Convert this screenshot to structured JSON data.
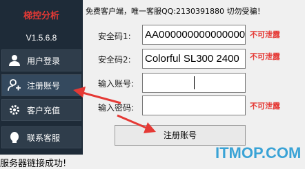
{
  "sidebar": {
    "app_title": "梯控分析",
    "version": "V1.5.6.8",
    "items": [
      {
        "label": "用户登录",
        "icon": "user-icon"
      },
      {
        "label": "注册账号",
        "icon": "user-add-icon"
      },
      {
        "label": "客户充值",
        "icon": "gear-icon"
      },
      {
        "label": "联系客服",
        "icon": "chat-icon"
      }
    ]
  },
  "notice": "免费客户端，唯一客服QQ:2130391880 切勿受骗！",
  "form": {
    "code1_label": "安全码1:",
    "code1_value": "AA000000000000000",
    "code2_label": "安全码2:",
    "code2_value": "Colorful SL300 2400",
    "account_label": "输入账号:",
    "account_value": "",
    "password_label": "输入密码:",
    "password_value": "",
    "warn_text": "不可泄露"
  },
  "register_button": "注册账号",
  "status": "服务器链接成功!",
  "watermark": "ITMOP.COM",
  "colors": {
    "sidebar_bg": "#1e2b38",
    "title_red": "#e53935",
    "arrow_red": "#e53935",
    "watermark_blue": "#3aa3d6"
  }
}
